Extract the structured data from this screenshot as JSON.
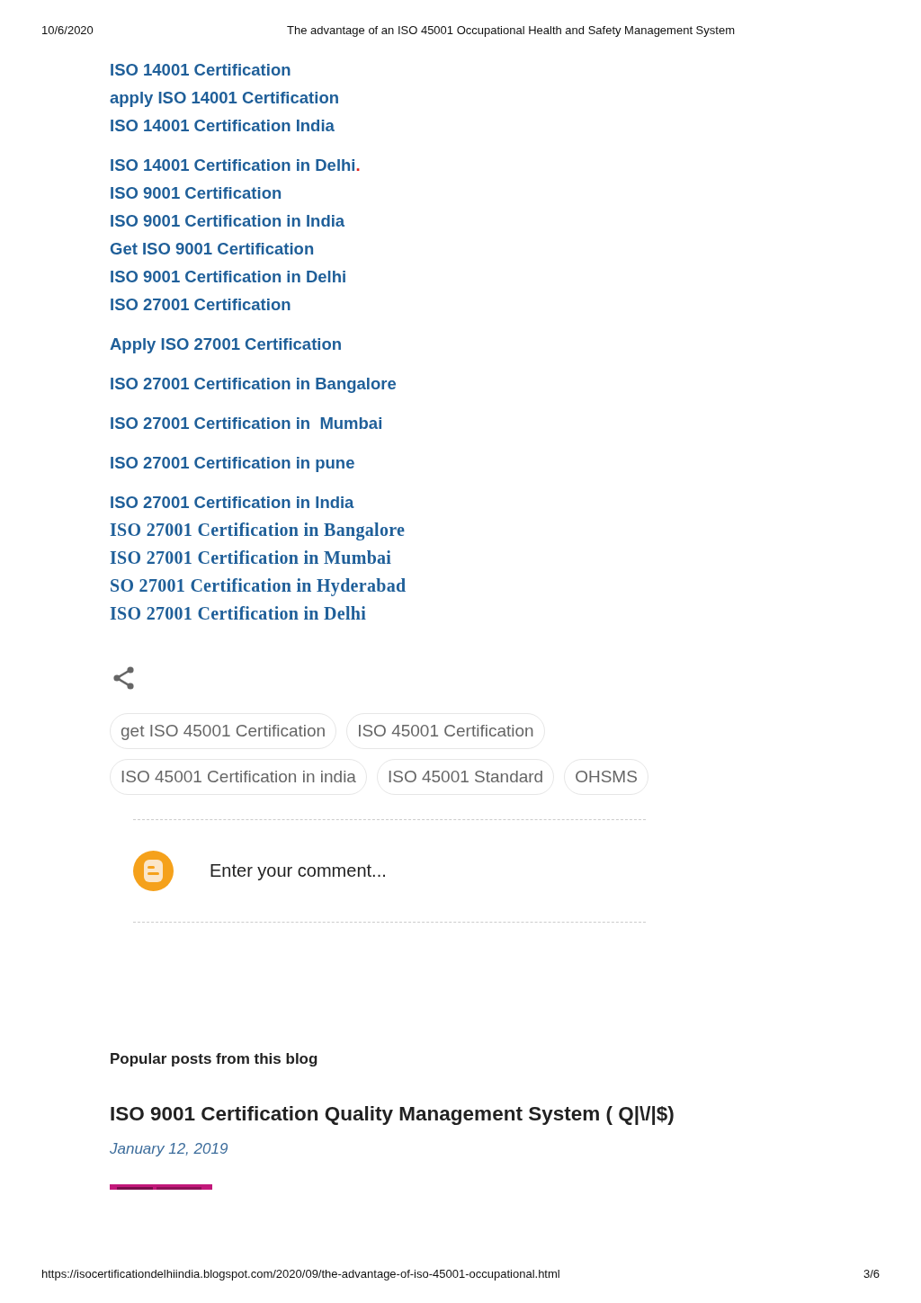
{
  "print_header": {
    "date": "10/6/2020",
    "title": "The advantage of an ISO 45001 Occupational Health and Safety Management System"
  },
  "link_blocks": [
    {
      "links": [
        {
          "text": "ISO 14001 Certification",
          "kind": "sans"
        },
        {
          "text": "apply ISO 14001 Certification",
          "kind": "sans"
        },
        {
          "text": "ISO 14001 Certification India",
          "kind": "sans"
        }
      ]
    },
    {
      "links": [
        {
          "text": "ISO 14001 Certification in Delhi",
          "kind": "sans",
          "mark": "."
        },
        {
          "text": "ISO 9001 Certification",
          "kind": "sans"
        },
        {
          "text": "ISO 9001 Certification in India",
          "kind": "sans"
        },
        {
          "text": "Get ISO 9001 Certification",
          "kind": "sans"
        },
        {
          "text": "ISO 9001 Certification in Delhi",
          "kind": "sans"
        },
        {
          "text": "ISO 27001 Certification",
          "kind": "sans"
        }
      ]
    },
    {
      "links": [
        {
          "text": "Apply ISO 27001 Certification",
          "kind": "sans"
        }
      ]
    },
    {
      "links": [
        {
          "text": "ISO 27001 Certification in Bangalore",
          "kind": "sans"
        }
      ]
    },
    {
      "links": [
        {
          "text": "ISO 27001 Certification in  Mumbai",
          "kind": "sans"
        }
      ]
    },
    {
      "links": [
        {
          "text": "ISO 27001 Certification in pune",
          "kind": "sans"
        }
      ]
    },
    {
      "links": [
        {
          "text": "ISO 27001 Certification in India",
          "kind": "sans"
        },
        {
          "text": "ISO 27001 Certification in Bangalore",
          "kind": "serif"
        },
        {
          "text": "ISO 27001 Certification in Mumbai",
          "kind": "serif"
        },
        {
          "text": "SO 27001 Certification in Hyderabad",
          "kind": "serif"
        },
        {
          "text": "ISO 27001 Certification in Delhi",
          "kind": "serif"
        }
      ]
    }
  ],
  "labels": [
    "get ISO 45001 Certification",
    "ISO 45001 Certification",
    "ISO 45001 Certification in india",
    "ISO 45001 Standard",
    "OHSMS"
  ],
  "comment": {
    "placeholder": "Enter your comment..."
  },
  "popular_posts": {
    "heading": "Popular posts from this blog",
    "post_title": "ISO 9001 Certification Quality Management System ( Q|\\/|$)",
    "date": "January 12, 2019"
  },
  "print_footer": {
    "url": "https://isocertificationdelhiindia.blogspot.com/2020/09/the-advantage-of-iso-45001-occupational.html",
    "page": "3/6"
  }
}
